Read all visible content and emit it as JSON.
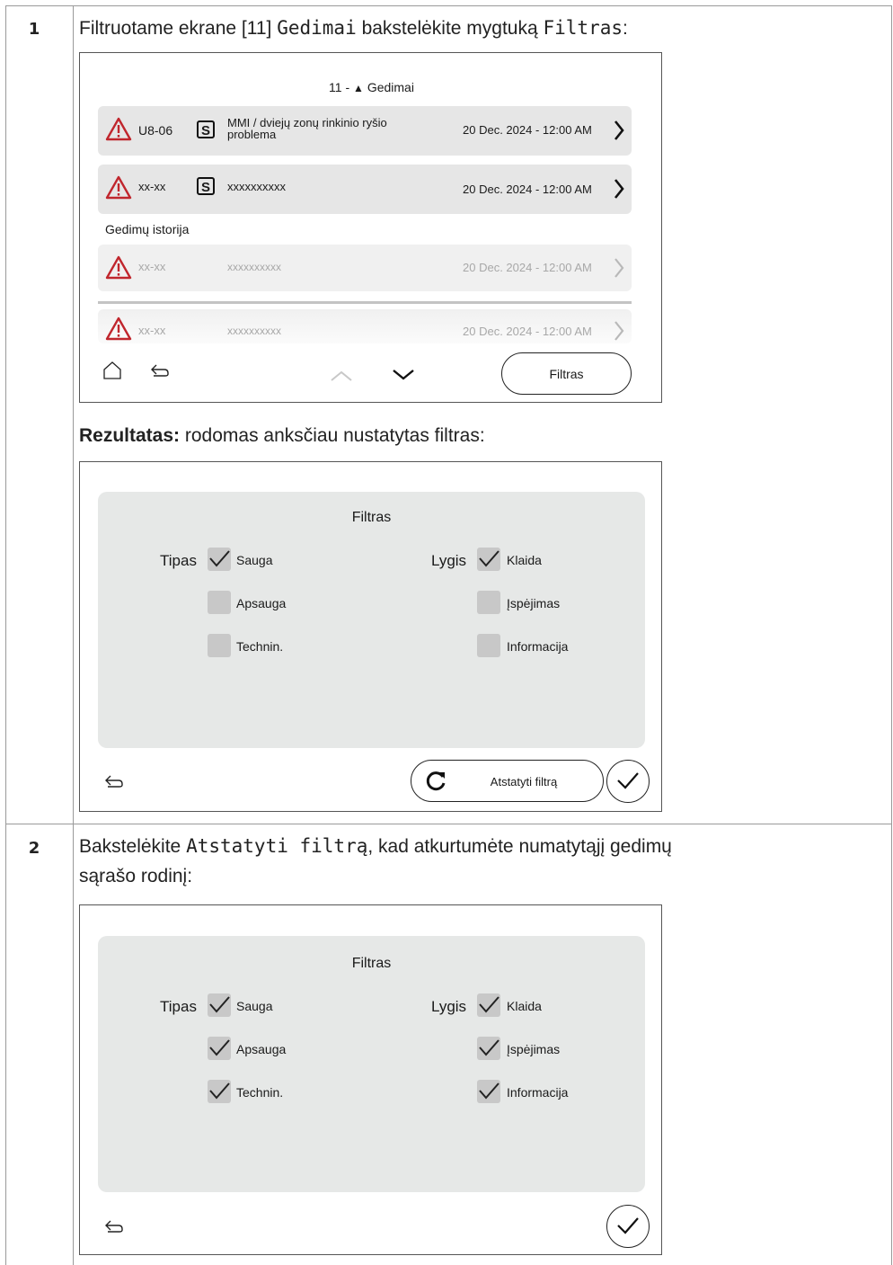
{
  "steps": [
    {
      "number": "1",
      "instruction_pre": "Filtruotame ekrane [11] ",
      "instruction_code1": "Gedimai",
      "instruction_mid": " bakstelėkite mygtuką ",
      "instruction_code2": "Filtras",
      "instruction_post": ":",
      "result_label": "Rezultatas:",
      "result_text": " rodomas anksčiau nustatytas filtras:"
    },
    {
      "number": "2",
      "instruction_pre": "Bakstelėkite ",
      "instruction_code": "Atstatyti filtrą",
      "instruction_post": ", kad atkurtumėte numatytąjį gedimų",
      "instruction_line2": "sąrašo rodinį:"
    }
  ],
  "fault_screen": {
    "title_prefix": "11 - ",
    "title_icon": "warning-triangle-icon",
    "title": "Gedimai",
    "active_faults": [
      {
        "code": "U8-06",
        "badge": "S",
        "description_line1": "MMI / dviejų zonų rinkinio ryšio",
        "description_line2": "problema",
        "timestamp": "20 Dec. 2024 - 12:00 AM"
      },
      {
        "code": "xx-xx",
        "badge": "S",
        "description_line1": "xxxxxxxxxx",
        "description_line2": "",
        "timestamp": "20 Dec. 2024 - 12:00 AM"
      }
    ],
    "history_label": "Gedimų istorija",
    "history_faults": [
      {
        "code": "xx-xx",
        "description": "xxxxxxxxxx",
        "timestamp": "20 Dec. 2024 - 12:00 AM"
      },
      {
        "code": "xx-xx",
        "description": "xxxxxxxxxx",
        "timestamp": "20 Dec. 2024 - 12:00 AM"
      }
    ],
    "filter_button": "Filtras"
  },
  "filter_screen_before": {
    "title": "Filtras",
    "type_label": "Tipas",
    "level_label": "Lygis",
    "type_options": [
      {
        "label": "Sauga",
        "checked": true
      },
      {
        "label": "Apsauga",
        "checked": false
      },
      {
        "label": "Technin.",
        "checked": false
      }
    ],
    "level_options": [
      {
        "label": "Klaida",
        "checked": true
      },
      {
        "label": "Įspėjimas",
        "checked": false
      },
      {
        "label": "Informacija",
        "checked": false
      }
    ],
    "reset_button": "Atstatyti filtrą"
  },
  "filter_screen_after": {
    "title": "Filtras",
    "type_label": "Tipas",
    "level_label": "Lygis",
    "type_options": [
      {
        "label": "Sauga",
        "checked": true
      },
      {
        "label": "Apsauga",
        "checked": true
      },
      {
        "label": "Technin.",
        "checked": true
      }
    ],
    "level_options": [
      {
        "label": "Klaida",
        "checked": true
      },
      {
        "label": "Įspėjimas",
        "checked": true
      },
      {
        "label": "Informacija",
        "checked": true
      }
    ]
  },
  "colors": {
    "warning": "#c0262d",
    "panel": "#e6e8e7",
    "row": "#e6e6e6",
    "faded_text": "#a8a8a8"
  }
}
